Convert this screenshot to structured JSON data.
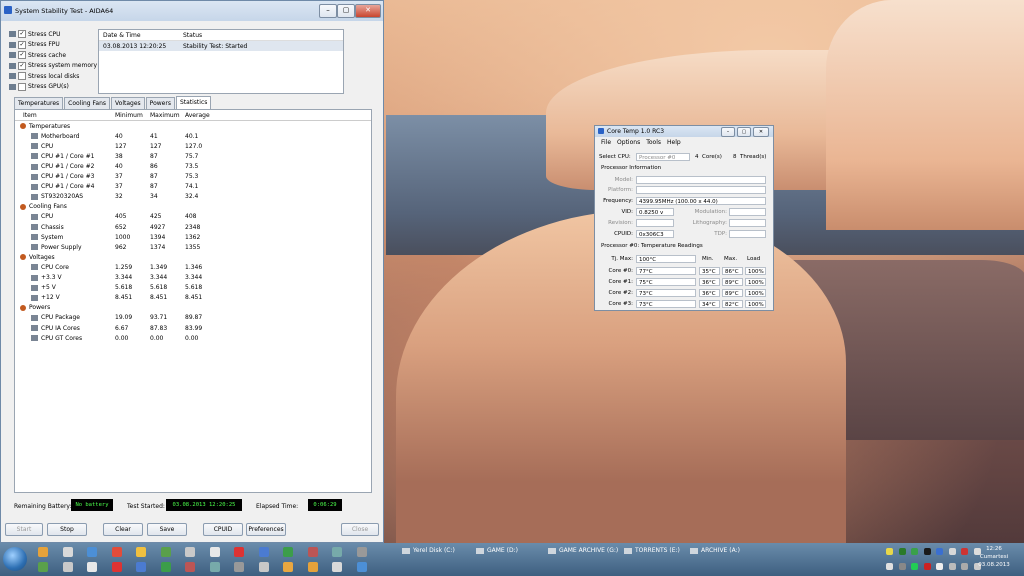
{
  "aida": {
    "title": "System Stability Test - AIDA64",
    "stress": [
      {
        "label": "Stress CPU",
        "checked": true
      },
      {
        "label": "Stress FPU",
        "checked": true
      },
      {
        "label": "Stress cache",
        "checked": true
      },
      {
        "label": "Stress system memory",
        "checked": true
      },
      {
        "label": "Stress local disks",
        "checked": false
      },
      {
        "label": "Stress GPU(s)",
        "checked": false
      }
    ],
    "log": {
      "col_date": "Date & Time",
      "col_status": "Status",
      "row_date": "03.08.2013 12:20:25",
      "row_status": "Stability Test: Started"
    },
    "tabs": [
      "Temperatures",
      "Cooling Fans",
      "Voltages",
      "Powers",
      "Statistics"
    ],
    "stats_headers": [
      "Item",
      "Minimum",
      "Maximum",
      "Average"
    ],
    "groups": [
      {
        "name": "Temperatures",
        "rows": [
          [
            "Motherboard",
            "40",
            "41",
            "40.1"
          ],
          [
            "CPU",
            "127",
            "127",
            "127.0"
          ],
          [
            "CPU #1 / Core #1",
            "38",
            "87",
            "75.7"
          ],
          [
            "CPU #1 / Core #2",
            "40",
            "86",
            "73.5"
          ],
          [
            "CPU #1 / Core #3",
            "37",
            "87",
            "75.3"
          ],
          [
            "CPU #1 / Core #4",
            "37",
            "87",
            "74.1"
          ],
          [
            "ST9320320AS",
            "32",
            "34",
            "32.4"
          ]
        ]
      },
      {
        "name": "Cooling Fans",
        "rows": [
          [
            "CPU",
            "405",
            "425",
            "408"
          ],
          [
            "Chassis",
            "652",
            "4927",
            "2348"
          ],
          [
            "System",
            "1000",
            "1394",
            "1362"
          ],
          [
            "Power Supply",
            "962",
            "1374",
            "1355"
          ]
        ]
      },
      {
        "name": "Voltages",
        "rows": [
          [
            "CPU Core",
            "1.259",
            "1.349",
            "1.346"
          ],
          [
            "+3.3 V",
            "3.344",
            "3.344",
            "3.344"
          ],
          [
            "+5 V",
            "5.618",
            "5.618",
            "5.618"
          ],
          [
            "+12 V",
            "8.451",
            "8.451",
            "8.451"
          ]
        ]
      },
      {
        "name": "Powers",
        "rows": [
          [
            "CPU Package",
            "19.09",
            "93.71",
            "89.87"
          ],
          [
            "CPU IA Cores",
            "6.67",
            "87.83",
            "83.99"
          ],
          [
            "CPU GT Cores",
            "0.00",
            "0.00",
            "0.00"
          ]
        ]
      }
    ],
    "remaining_battery_label": "Remaining Battery:",
    "remaining_battery": "No battery",
    "test_started_label": "Test Started:",
    "test_started": "03.08.2013 12:20:25",
    "elapsed_label": "Elapsed Time:",
    "elapsed": "0:06:29",
    "buttons": {
      "start": "Start",
      "stop": "Stop",
      "clear": "Clear",
      "save": "Save",
      "cpuid": "CPUID",
      "preferences": "Preferences",
      "close": "Close"
    }
  },
  "coretemp": {
    "title": "Core Temp 1.0 RC3",
    "menu": [
      "File",
      "Options",
      "Tools",
      "Help"
    ],
    "select_cpu_label": "Select CPU:",
    "select_cpu": "Processor #0",
    "cores_count": "4",
    "cores_label": "Core(s)",
    "threads_count": "8",
    "threads_label": "Thread(s)",
    "proc_info": "Processor Information",
    "model_label": "Model:",
    "platform_label": "Platform:",
    "frequency_label": "Frequency:",
    "frequency": "4399.95MHz (100.00 x 44.0)",
    "vid_label": "VID:",
    "vid": "0.8250 v",
    "modulation_label": "Modulation:",
    "revision_label": "Revision:",
    "lithography_label": "Lithography:",
    "cpuid_label": "CPUID:",
    "cpuid": "0x306C3",
    "tdp_label": "TDP:",
    "temp_section": "Processor #0: Temperature Readings",
    "tjmax_label": "Tj. Max:",
    "tjmax": "100°C",
    "min_label": "Min.",
    "max_label": "Max.",
    "load_label": "Load",
    "cores": [
      {
        "name": "Core #0:",
        "temp": "77°C",
        "min": "35°C",
        "max": "86°C",
        "load": "100%"
      },
      {
        "name": "Core #1:",
        "temp": "75°C",
        "min": "36°C",
        "max": "89°C",
        "load": "100%"
      },
      {
        "name": "Core #2:",
        "temp": "73°C",
        "min": "36°C",
        "max": "89°C",
        "load": "100%"
      },
      {
        "name": "Core #3:",
        "temp": "73°C",
        "min": "34°C",
        "max": "82°C",
        "load": "100%"
      }
    ]
  },
  "taskbar": {
    "drives": [
      "Yerel Disk (C:)",
      "GAME (D:)",
      "GAME ARCHIVE (G:)",
      "TORRENTS (E:)",
      "ARCHIVE (A:)"
    ],
    "time": "12:26",
    "day": "Cumartesi",
    "date": "03.08.2013"
  }
}
